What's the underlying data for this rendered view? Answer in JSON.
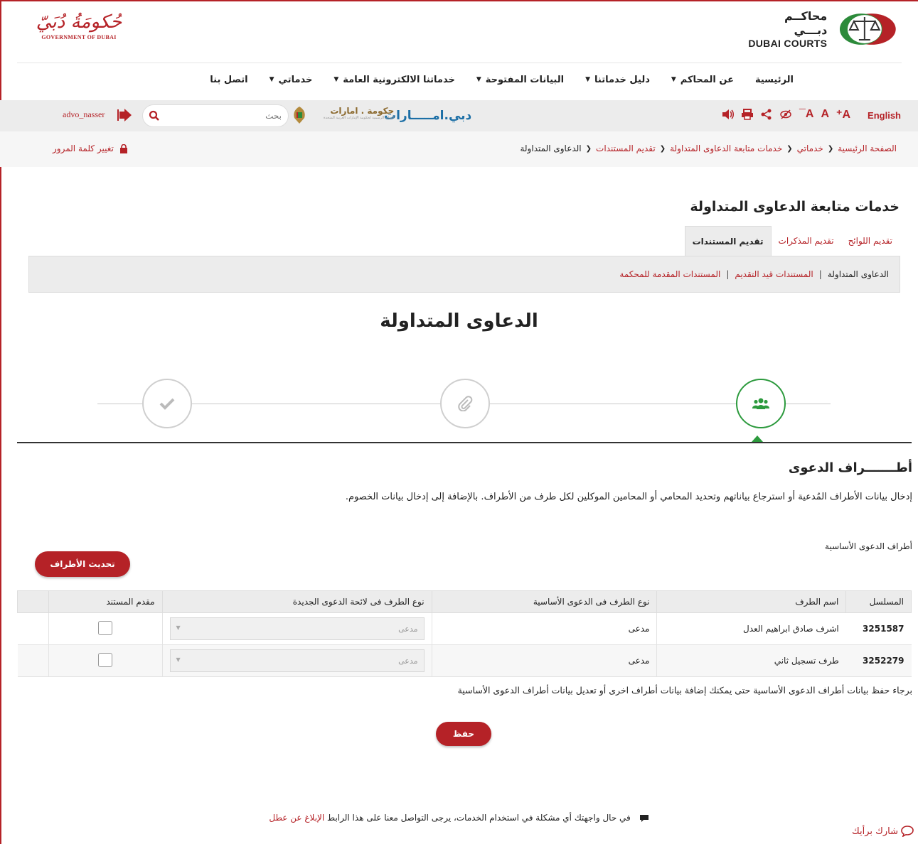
{
  "header": {
    "gov_logo_ar": "حُكومَةُ دُبَيّ",
    "gov_logo_en": "GOVERNMENT OF DUBAI",
    "courts_ar": "محاكــم دبـــي",
    "courts_en": "DUBAI COURTS"
  },
  "nav": {
    "items": [
      {
        "label": "الرئيسية",
        "caret": ""
      },
      {
        "label": "عن المحاكم",
        "caret": "▼"
      },
      {
        "label": "دليل خدماتنا",
        "caret": "▼"
      },
      {
        "label": "البيانات المفتوحة",
        "caret": "▼"
      },
      {
        "label": "خدماتنا الالكترونية العامة",
        "caret": "▼"
      },
      {
        "label": "خدماتي",
        "caret": "▼"
      },
      {
        "label": "اتصل بنا",
        "caret": ""
      }
    ]
  },
  "toolbar": {
    "lang": "English",
    "dubai_brand": "دبي.امـــــارات",
    "uae_brand": "حكومة . امارات",
    "uae_brand_sub": "البوابة الرسمية لحكومة الإمارات العربية المتحدة",
    "search_placeholder": "بحث",
    "username": "advo_nasser"
  },
  "breadcrumb": {
    "items": [
      "الصفحة الرئيسية",
      "خدماتي",
      "خدمات متابعة الدعاوى المتداولة",
      "تقديم المستندات",
      "الدعاوى المتداولة"
    ],
    "change_password": "تغيير كلمة المرور"
  },
  "section_title": "خدمات متابعة الدعاوى المتداولة",
  "tabs": [
    {
      "label": "تقديم اللوائح"
    },
    {
      "label": "تقديم المذكرات"
    },
    {
      "label": "تقديم المستندات"
    }
  ],
  "subtabs": {
    "current": "الدعاوى المتداولة",
    "link1": "المستندات قيد التقديم",
    "link2": "المستندات المقدمة للمحكمة",
    "sep": "|"
  },
  "page_heading": "الدعاوى المتداولة",
  "parties": {
    "title": "أطـــــــراف الدعوى",
    "description": "إدخال بيانات الأطراف المُدعية أو استرجاع بياناتهم وتحديد المحامي أو المحامين الموكلين لكل طرف من الأطراف. بالإضافة إلى إدخال بيانات الخصوم.",
    "main_label": "أطراف الدعوى الأساسية",
    "refresh_button": "تحديث الأطراف"
  },
  "table": {
    "headers": [
      "المسلسل",
      "اسم الطرف",
      "نوع الطرف فى الدعوى الأساسية",
      "نوع الطرف فى لائحة الدعوى الجديدة",
      "مقدم المستند"
    ],
    "rows": [
      {
        "serial": "3251587",
        "name": "اشرف صادق ابراهيم العدل",
        "type": "مدعى",
        "new_type": "مدعى"
      },
      {
        "serial": "3252279",
        "name": "طرف تسجيل ثاني",
        "type": "مدعى",
        "new_type": "مدعى"
      }
    ]
  },
  "save_note": "برجاء حفظ بيانات أطراف الدعوى الأساسية حتى يمكنك إضافة بيانات أطراف اخرى أو تعديل بيانات أطراف الدعوى الأساسية",
  "save_button": "حفظ",
  "support": {
    "text": "في حال واجهتك أي مشكلة في استخدام الخدمات، يرجى التواصل معنا على هذا الرابط",
    "link": "الإبلاغ عن عطل"
  },
  "feedback": "شارك برأيك",
  "colors": {
    "brand": "#b52227",
    "active_step": "#2c9a3d",
    "bar": "#ececec"
  }
}
